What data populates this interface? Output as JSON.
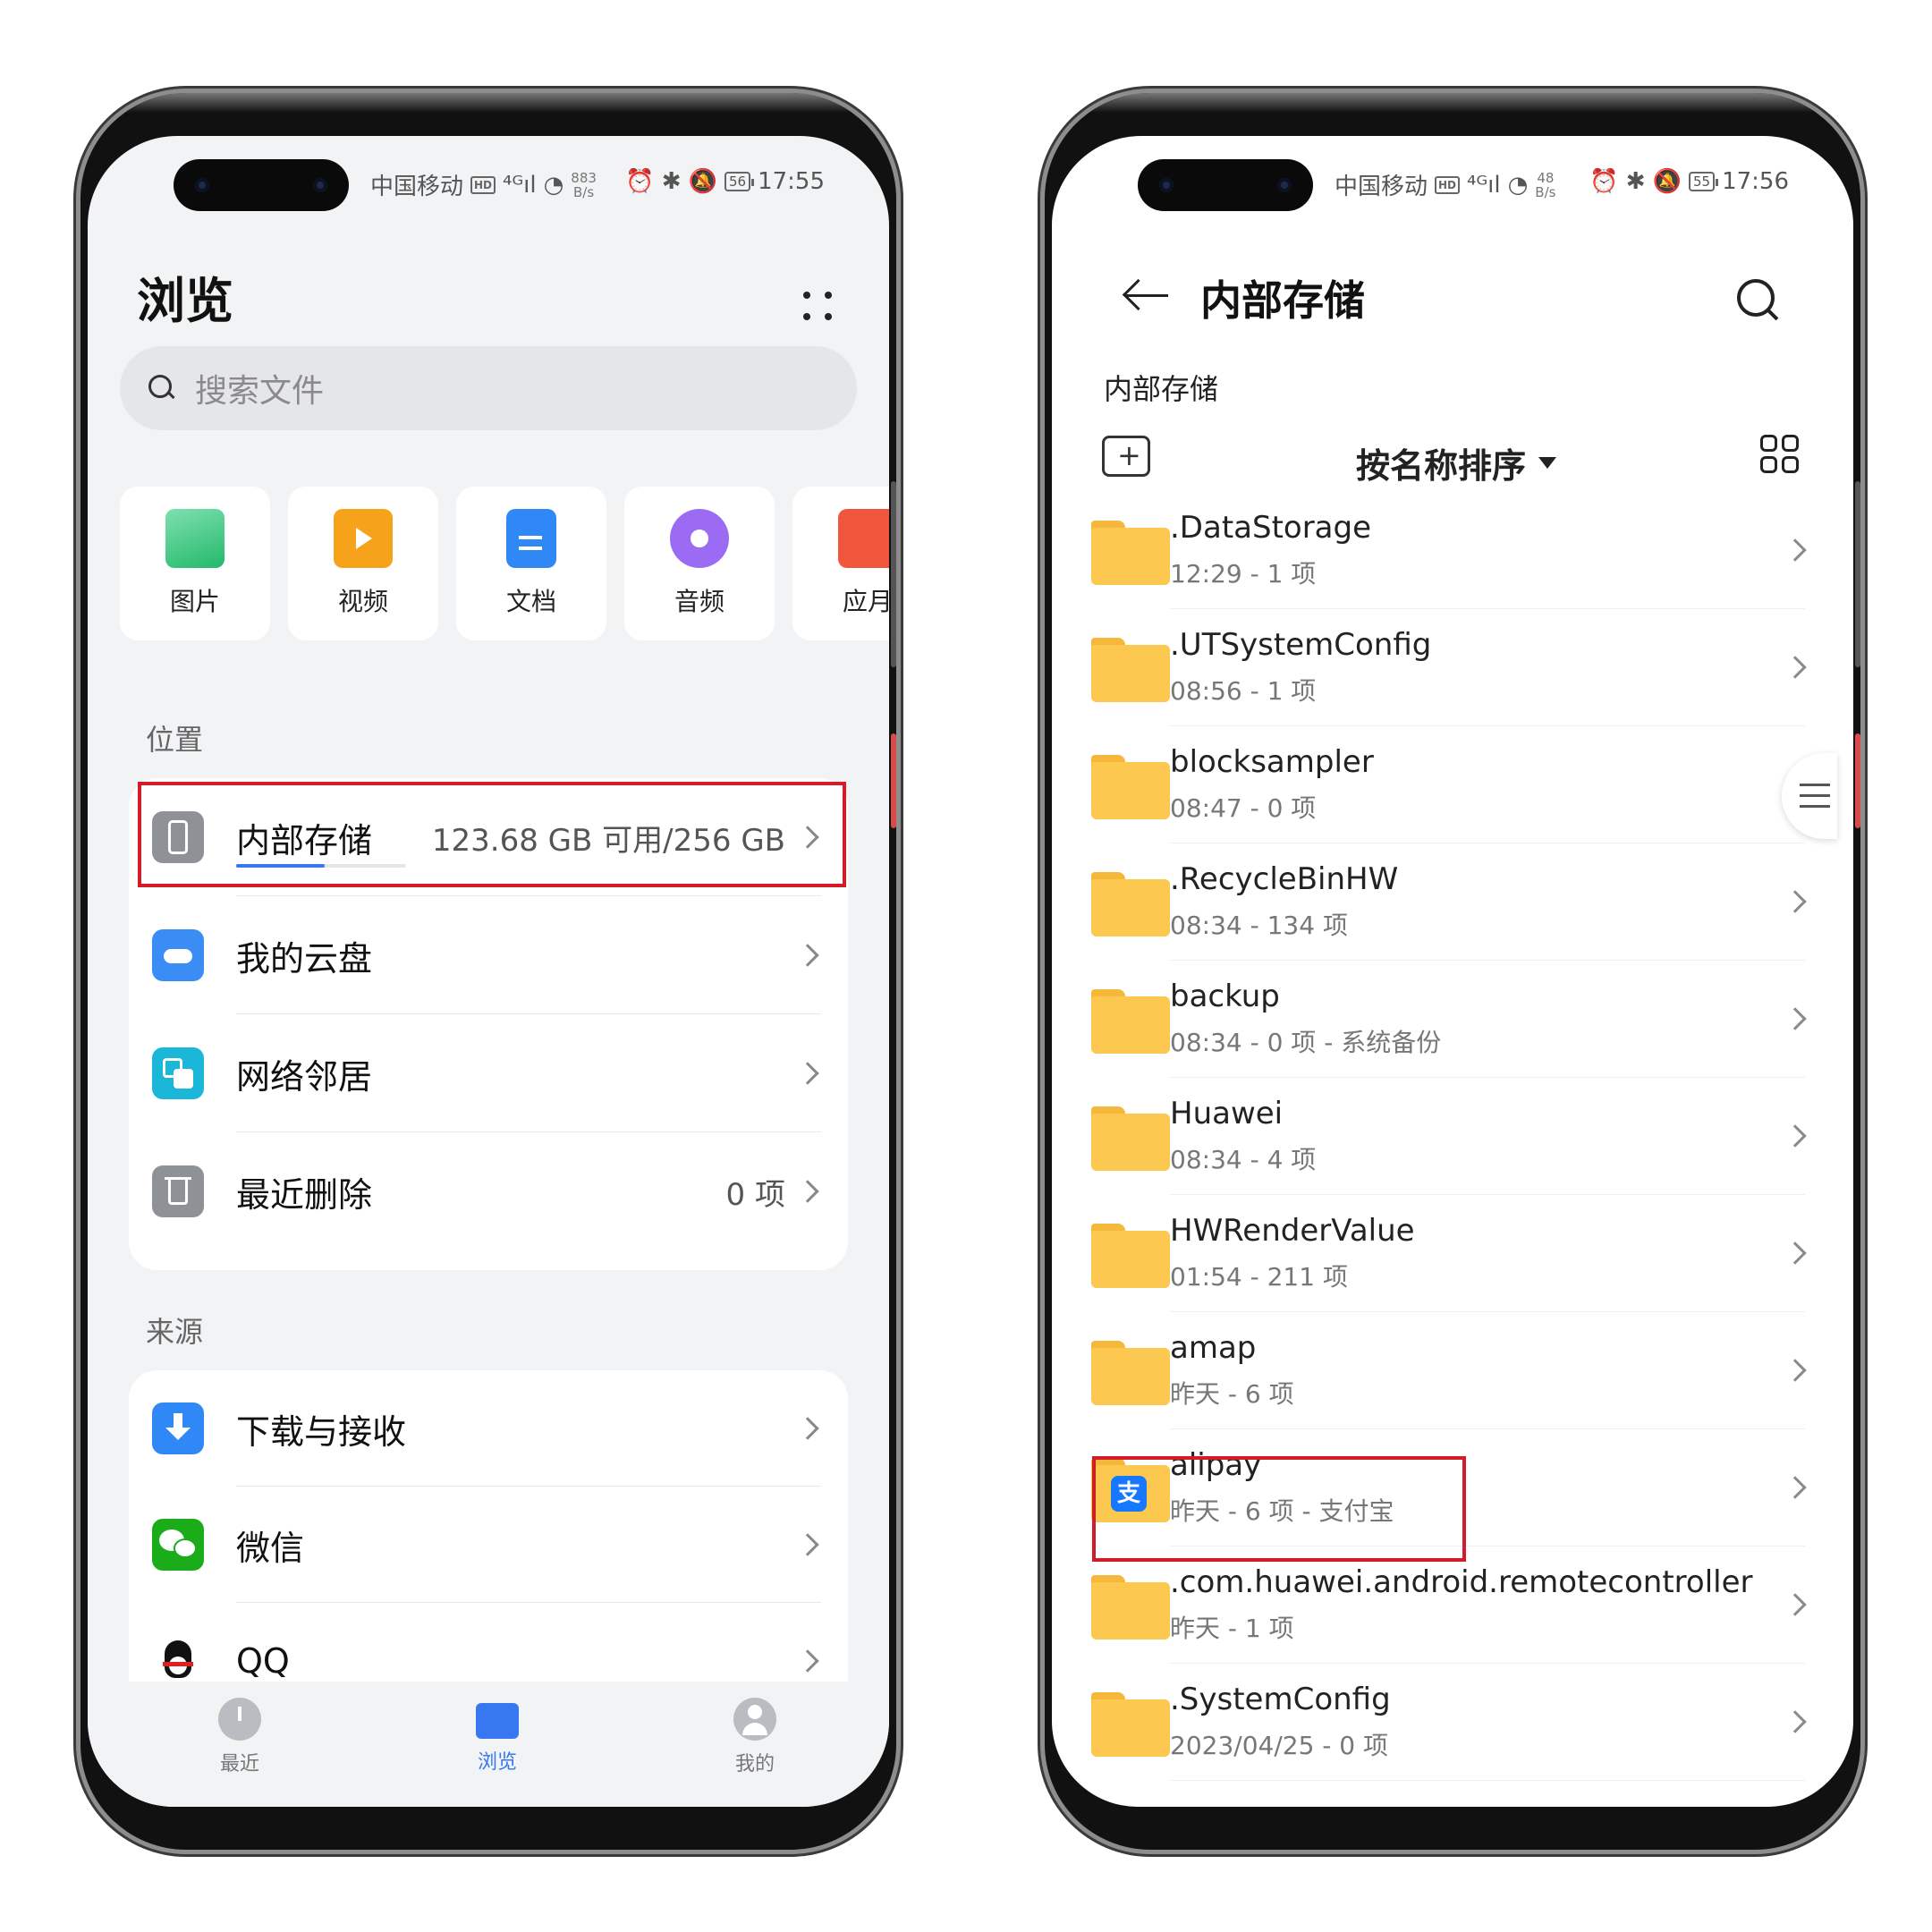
{
  "left_phone": {
    "status": {
      "carrier": "中国移动",
      "net_speed": "883",
      "net_speed_unit": "B/s",
      "battery": "56",
      "time": "17:55"
    },
    "title": "浏览",
    "search": {
      "placeholder": "搜索文件"
    },
    "categories": [
      {
        "label": "图片",
        "icon": "image-icon",
        "color": "#2fc37a"
      },
      {
        "label": "视频",
        "icon": "video-icon",
        "color": "#f7a21b"
      },
      {
        "label": "文档",
        "icon": "document-icon",
        "color": "#2f88f5"
      },
      {
        "label": "音频",
        "icon": "audio-icon",
        "color": "#9b6bf3"
      },
      {
        "label": "应月",
        "icon": "app-icon",
        "color": "#f0563c"
      }
    ],
    "location_header": "位置",
    "locations": [
      {
        "label": "内部存储",
        "value": "123.68 GB 可用/256 GB",
        "icon": "phone-storage-icon",
        "storage_used_fraction": 0.52
      },
      {
        "label": "我的云盘",
        "value": "",
        "icon": "cloud-drive-icon"
      },
      {
        "label": "网络邻居",
        "value": "",
        "icon": "network-icon"
      },
      {
        "label": "最近删除",
        "value": "0 项",
        "icon": "trash-icon"
      }
    ],
    "source_header": "来源",
    "sources": [
      {
        "label": "下载与接收",
        "icon": "download-icon"
      },
      {
        "label": "微信",
        "icon": "wechat-icon"
      },
      {
        "label": "QQ",
        "icon": "qq-icon"
      }
    ],
    "tabs": [
      {
        "label": "最近",
        "icon": "clock-icon"
      },
      {
        "label": "浏览",
        "icon": "folder-icon",
        "active": true
      },
      {
        "label": "我的",
        "icon": "user-icon"
      }
    ]
  },
  "right_phone": {
    "status": {
      "carrier": "中国移动",
      "net_speed": "48",
      "net_speed_unit": "B/s",
      "battery": "55",
      "time": "17:56"
    },
    "title": "内部存储",
    "breadcrumb": "内部存储",
    "sort_label": "按名称排序",
    "files": [
      {
        "name": ".DataStorage",
        "meta": "12:29 - 1 项"
      },
      {
        "name": ".UTSystemConfig",
        "meta": "08:56 - 1 项"
      },
      {
        "name": "blocksampler",
        "meta": "08:47 - 0 项"
      },
      {
        "name": ".RecycleBinHW",
        "meta": "08:34 - 134 项"
      },
      {
        "name": "backup",
        "meta": "08:34 - 0 项 - 系统备份"
      },
      {
        "name": "Huawei",
        "meta": "08:34 - 4 项"
      },
      {
        "name": "HWRenderValue",
        "meta": "01:54 - 211 项"
      },
      {
        "name": "amap",
        "meta": "昨天 - 6 项"
      },
      {
        "name": "alipay",
        "meta": "昨天 - 6 项 - 支付宝",
        "badge": "支"
      },
      {
        "name": ".com.huawei.android.remotecontroller",
        "meta": "昨天 - 1 项"
      },
      {
        "name": ".SystemConfig",
        "meta": "2023/04/25 - 0 项"
      }
    ]
  },
  "colors": {
    "accent": "#3778f0",
    "highlight": "#d41c29",
    "folder": "#fcc84f"
  }
}
